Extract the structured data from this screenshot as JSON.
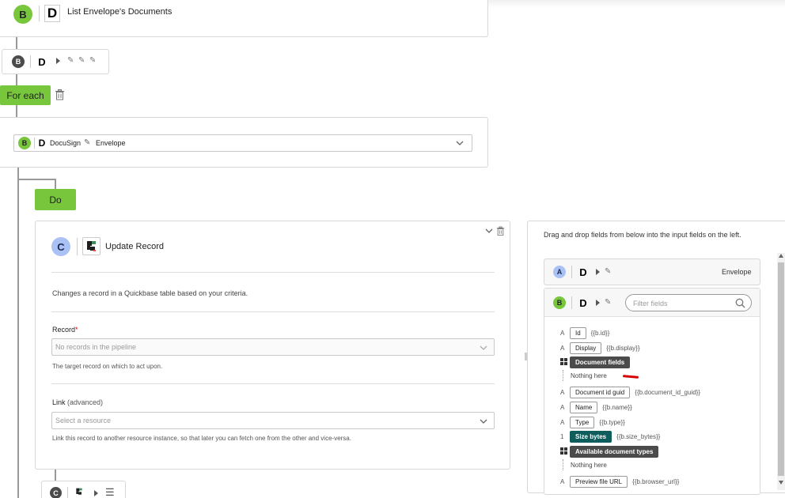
{
  "top_step": {
    "badge": "B",
    "dletter": "D",
    "title": "List Envelope's Documents"
  },
  "collapsed_step": {
    "badge": "B",
    "dletter": "D"
  },
  "for_each": {
    "label": "For each"
  },
  "loop_source": {
    "badge": "B",
    "dletter": "D",
    "service": "DocuSign",
    "object": "Envelope"
  },
  "do_block": {
    "label": "Do"
  },
  "update_record": {
    "badge": "C",
    "title": "Update Record",
    "description": "Changes a record in a Quickbase table based on your criteria.",
    "record_label": "Record",
    "record_required": "*",
    "record_placeholder": "No records in the pipeline",
    "record_help": "The target record on which to act upon.",
    "link_label": "Link",
    "link_suffix": "(advanced)",
    "link_placeholder": "Select a resource",
    "link_help": "Link this record to another resource instance, so that later you can fetch one from the other and vice-versa."
  },
  "bottom_step": {
    "badge": "C"
  },
  "right_panel": {
    "hint": "Drag and drop fields from below into the input fields on the left.",
    "step_a": {
      "badge": "A",
      "dletter": "D",
      "name": "Envelope"
    },
    "step_b": {
      "badge": "B",
      "dletter": "D",
      "filter_placeholder": "Filter fields"
    },
    "fields": [
      {
        "type": "A",
        "label": "Id",
        "expr": "{{b.id}}",
        "style": "normal"
      },
      {
        "type": "A",
        "label": "Display",
        "expr": "{{b.display}}",
        "style": "normal"
      },
      {
        "type": "grid",
        "label": "Document fields",
        "expr": "",
        "style": "dark"
      },
      {
        "type": "",
        "label": "Nothing here",
        "expr": "",
        "style": "empty"
      },
      {
        "type": "A",
        "label": "Document id guid",
        "expr": "{{b.document_id_guid}}",
        "style": "normal"
      },
      {
        "type": "A",
        "label": "Name",
        "expr": "{{b.name}}",
        "style": "normal"
      },
      {
        "type": "A",
        "label": "Type",
        "expr": "{{b.type}}",
        "style": "normal"
      },
      {
        "type": "1",
        "label": "Size bytes",
        "expr": "{{b.size_bytes}}",
        "style": "teal"
      },
      {
        "type": "grid",
        "label": "Available document types",
        "expr": "",
        "style": "dark"
      },
      {
        "type": "",
        "label": "Nothing here",
        "expr": "",
        "style": "empty"
      },
      {
        "type": "A",
        "label": "Preview file URL",
        "expr": "{{b.browser_url}}",
        "style": "normal"
      }
    ]
  },
  "colors": {
    "green": "#78c63c",
    "dark": "#4b4b4b",
    "blue": "#a9c1f3",
    "teal": "#0e5c5c",
    "annotation_red": "#d40000"
  }
}
